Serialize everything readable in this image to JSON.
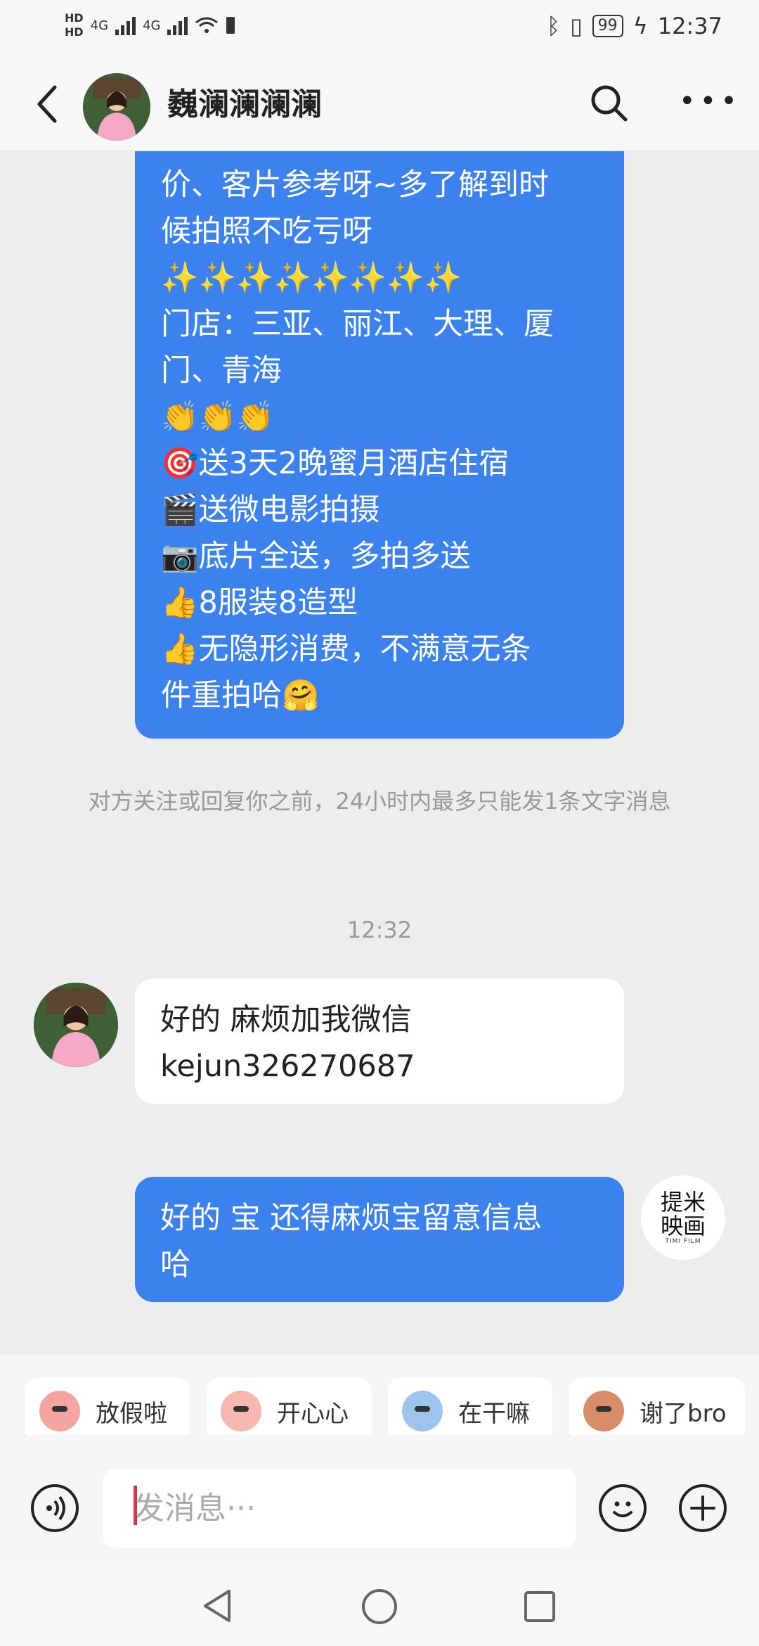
{
  "status_bar": {
    "hd1": "HD",
    "hd2": "HD",
    "net1": "4G",
    "net2": "4G",
    "battery": "99",
    "time": "12:37"
  },
  "header": {
    "title": "巍澜澜澜澜",
    "back_icon": "chevron-left-icon",
    "search_icon": "search-icon",
    "more_icon": "more-dots-icon"
  },
  "messages": {
    "promo_lines": [
      "价、客片参考呀~多了解到时",
      "候拍照不吃亏呀",
      "✨✨✨✨✨✨✨✨",
      "门店：三亚、丽江、大理、厦",
      "门、青海",
      "👏👏👏",
      "🎯送3天2晚蜜月酒店住宿",
      "🎬送微电影拍摄",
      "📷底片全送，多拍多送",
      "👍8服装8造型",
      "👍无隐形消费，不满意无条",
      "件重拍哈🤗"
    ],
    "notice": "对方关注或回复你之前，24小时内最多只能发1条文字消息",
    "time": "12:32",
    "incoming": [
      "好的 麻烦加我微信",
      "kejun326270687"
    ],
    "outgoing": [
      "好的 宝 还得麻烦宝留意信息",
      "哈"
    ],
    "self_logo_line1": "提米",
    "self_logo_line2": "映画",
    "self_logo_small": "TIMI FILM"
  },
  "quick_replies": [
    {
      "label": "放假啦",
      "color": "#f3a6a0"
    },
    {
      "label": "开心心",
      "color": "#f5b8b0"
    },
    {
      "label": "在干嘛",
      "color": "#9cc4ec"
    },
    {
      "label": "谢了bro",
      "color": "#d88c68"
    }
  ],
  "input": {
    "placeholder": "发消息···",
    "voice_icon": "voice-icon",
    "emoji_icon": "emoji-icon",
    "add_icon": "plus-icon"
  },
  "colors": {
    "accent": "#3b82ef",
    "background": "#ededed"
  }
}
